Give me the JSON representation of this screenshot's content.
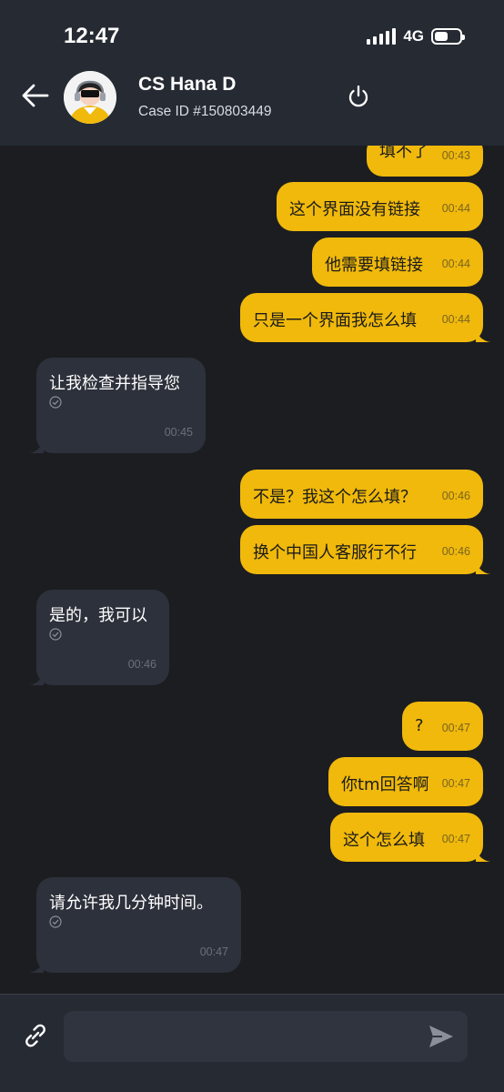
{
  "status_bar": {
    "time": "12:47",
    "network": "4G"
  },
  "header": {
    "contact_name": "CS Hana D",
    "case_id": "Case ID #150803449",
    "icons": [
      "back-arrow-icon",
      "agent-avatar",
      "power-icon"
    ]
  },
  "messages": [
    {
      "id": "m1",
      "dir": "out",
      "text": "填不了",
      "time": "00:43"
    },
    {
      "id": "m2",
      "dir": "out",
      "text": "这个界面没有链接",
      "time": "00:44"
    },
    {
      "id": "m3",
      "dir": "out",
      "text": "他需要填链接",
      "time": "00:44"
    },
    {
      "id": "m4",
      "dir": "out",
      "text": "只是一个界面我怎么填",
      "time": "00:44"
    },
    {
      "id": "m5",
      "dir": "in",
      "text": "让我检查并指导您",
      "time": "00:45",
      "status": "sent-check-icon"
    },
    {
      "id": "m6",
      "dir": "out",
      "text": "不是？我这个怎么填？",
      "time": "00:46"
    },
    {
      "id": "m7",
      "dir": "out",
      "text": "换个中国人客服行不行",
      "time": "00:46"
    },
    {
      "id": "m8",
      "dir": "in",
      "text": "是的，我可以",
      "time": "00:46",
      "status": "sent-check-icon"
    },
    {
      "id": "m9",
      "dir": "out",
      "text": "?",
      "time": "00:47"
    },
    {
      "id": "m10",
      "dir": "out",
      "text": "你tm回答啊",
      "time": "00:47"
    },
    {
      "id": "m11",
      "dir": "out",
      "text": "这个怎么填",
      "time": "00:47"
    },
    {
      "id": "m12",
      "dir": "in",
      "text": "请允许我几分钟时间。",
      "time": "00:47",
      "status": "sent-check-icon"
    }
  ],
  "composer": {
    "value": "",
    "placeholder": "",
    "icons": [
      "attach-link-icon",
      "send-icon"
    ]
  },
  "colors": {
    "header_bg": "#252a33",
    "background": "#1c1d21",
    "outgoing_bubble": "#f0b90b",
    "incoming_bubble": "#2d313b"
  }
}
